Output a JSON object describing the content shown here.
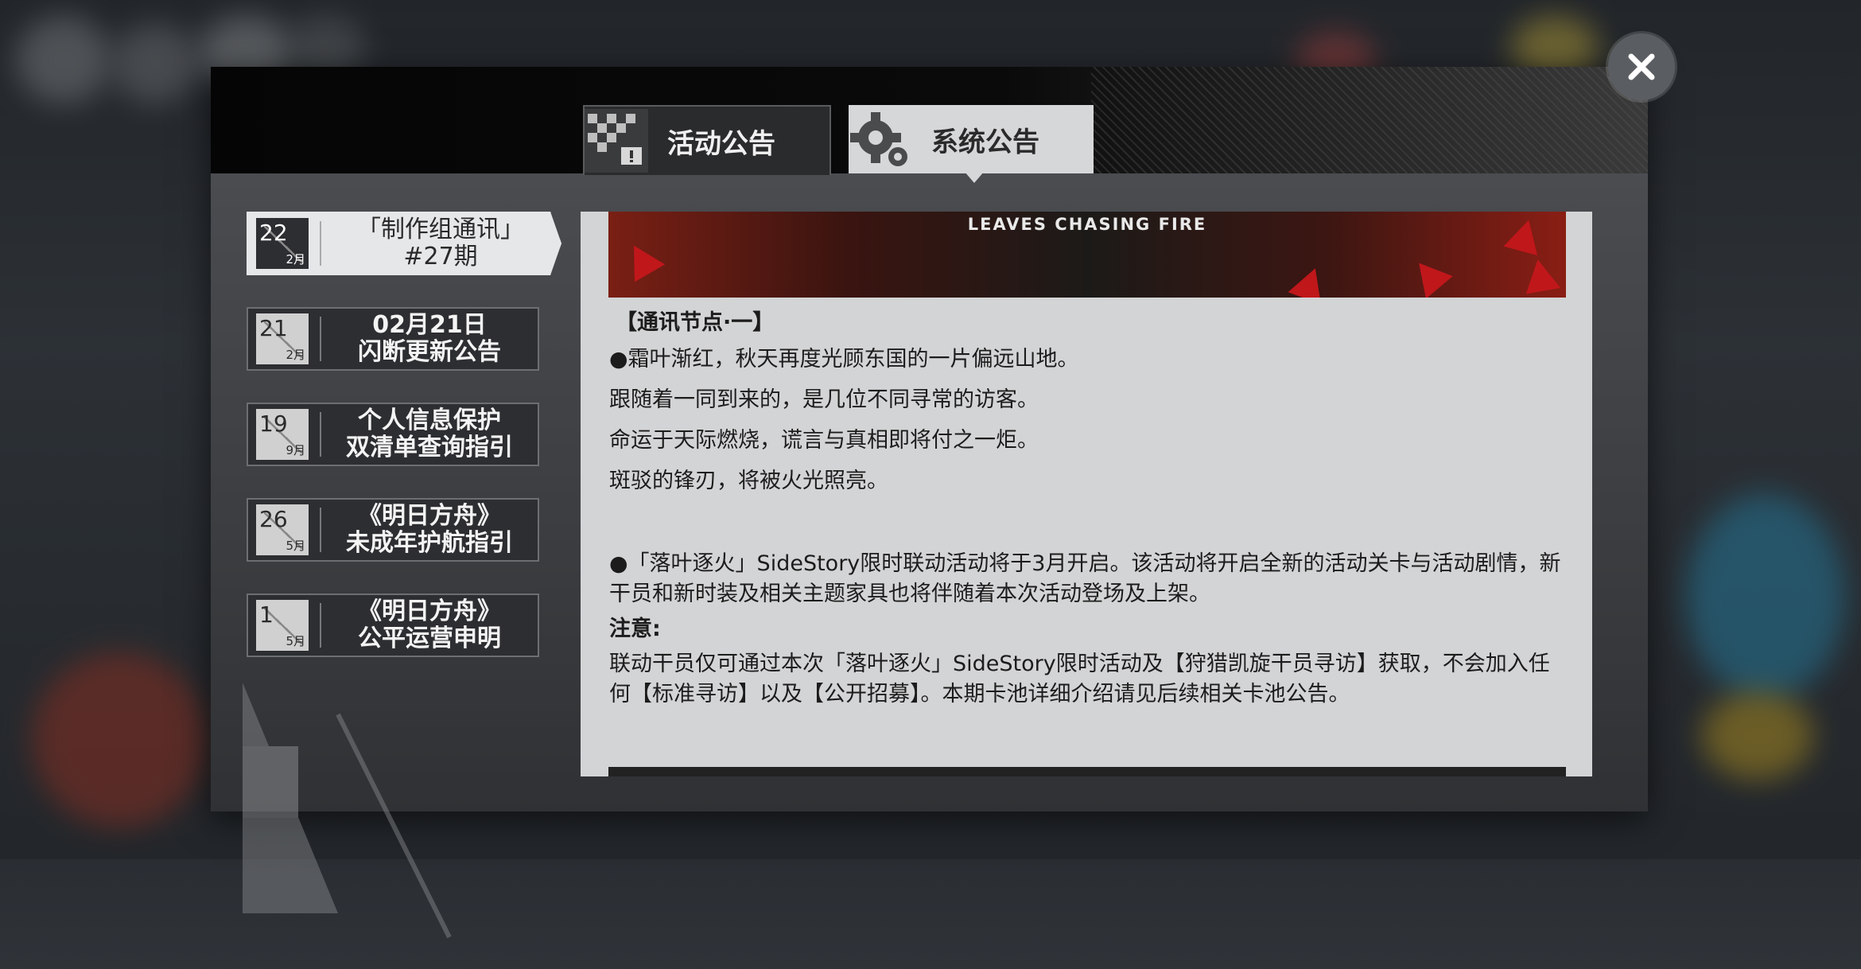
{
  "tabs": [
    {
      "label": "活动公告",
      "icon": "checkered-flag-icon"
    },
    {
      "label": "系统公告",
      "icon": "gear-icon"
    }
  ],
  "announcements": [
    {
      "day": "22",
      "month": "2月",
      "title_line1": "「制作组通讯」",
      "title_line2": "#27期"
    },
    {
      "day": "21",
      "month": "2月",
      "title_line1": "02月21日",
      "title_line2": "闪断更新公告"
    },
    {
      "day": "19",
      "month": "9月",
      "title_line1": "个人信息保护",
      "title_line2": "双清单查询指引"
    },
    {
      "day": "26",
      "month": "5月",
      "title_line1": "《明日方舟》",
      "title_line2": "未成年护航指引"
    },
    {
      "day": "1",
      "month": "5月",
      "title_line1": "《明日方舟》",
      "title_line2": "公平运营申明"
    }
  ],
  "banner": {
    "title": "LEAVES CHASING FIRE"
  },
  "article": {
    "heading": "【通讯节点·一】",
    "lines": [
      "●霜叶渐红，秋天再度光顾东国的一片偏远山地。",
      "跟随着一同到来的，是几位不同寻常的访客。",
      "命运于天际燃烧，谎言与真相即将付之一炬。",
      "斑驳的锋刃，将被火光照亮。"
    ],
    "event_paragraph": "●「落叶逐火」SideStory限时联动活动将于3月开启。该活动将开启全新的活动关卡与活动剧情，新干员和新时装及相关主题家具也将伴随着本次活动登场及上架。",
    "note_label": "注意:",
    "note_paragraph": "联动干员仅可通过本次「落叶逐火」SideStory限时活动及【狩猎凯旋干员寻访】获取，不会加入任何【标准寻访】以及【公开招募】。本期卡池详细介绍请见后续相关卡池公告。"
  },
  "watermark": "ODES ISLAND",
  "close_icon": "close-icon"
}
